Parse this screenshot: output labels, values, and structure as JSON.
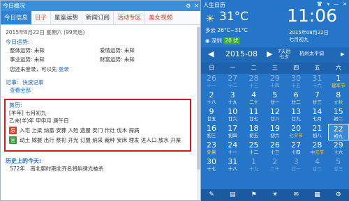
{
  "popup": {
    "title": "今日概况",
    "tabs": [
      {
        "label": "今日信息",
        "active": true,
        "red": false
      },
      {
        "label": "日子",
        "active": false,
        "red": true
      },
      {
        "label": "星座运势",
        "active": false,
        "red": false
      },
      {
        "label": "新闻订阅",
        "active": false,
        "red": false
      },
      {
        "label": "活动专区",
        "active": false,
        "red": true
      },
      {
        "label": "美女视频",
        "active": false,
        "red": true
      }
    ],
    "date_line": "2015年8月22日 星期六 (99天后)",
    "fortune_title": "今日运势:",
    "fortune": [
      [
        "整体运势: 未知",
        "爱情运势: 未知"
      ],
      [
        "事业运势: 未知",
        "财富运势: 未知"
      ]
    ],
    "login_text": "您还未登录，可以先",
    "login_link": "登录",
    "memo_title": "记事:",
    "memo_link": "快速记事",
    "view_all": "查看全部",
    "almanac_title": "黄历:",
    "almanac_line1": "[羊年] 七月初九",
    "almanac_line2": "乙未(羊)年 甲申月 庚午日",
    "ji_label": "忌",
    "ji_text": "入宅 上梁 纳畜 安葬 入殓 造屋 安门 作灶 伐木 探病",
    "yi_label": "宜",
    "yi_text": "动土 嫁娶 出行 祭祀 开光 订盟 纳采 裁种 安床 理发 进人口 放水 开渠",
    "history_title": "历史上的今天:",
    "history_item": "572年　南北朝时期北齐名将斛律光被杀"
  },
  "calendar": {
    "title": "人生日历",
    "weather_icon": "☀",
    "temperature": "31°C",
    "temp_range": "多云 26°C~31°C",
    "city": "深圳",
    "aqi": "20 优",
    "time": "11:06",
    "date_small": "2015年08月22日",
    "lunar_small": "七月初九",
    "month": "2015-08",
    "prev": "◀",
    "next": "▶",
    "holiday_line1": "7天后",
    "holiday_line2": "七夕",
    "timezone": "杭州太平调",
    "weekdays": [
      "日",
      "一",
      "二",
      "三",
      "四",
      "五",
      "六"
    ],
    "days": [
      {
        "d": "26",
        "s": "十一",
        "o": true
      },
      {
        "d": "27",
        "s": "十二",
        "o": true
      },
      {
        "d": "28",
        "s": "十三",
        "o": true
      },
      {
        "d": "29",
        "s": "十四",
        "o": true
      },
      {
        "d": "30",
        "s": "十五",
        "o": true
      },
      {
        "d": "31",
        "s": "十六",
        "o": true
      },
      {
        "d": "1",
        "s": "建军节",
        "h": true
      },
      {
        "d": "2",
        "s": "十八"
      },
      {
        "d": "3",
        "s": "十九"
      },
      {
        "d": "4",
        "s": "二十"
      },
      {
        "d": "5",
        "s": "廿一"
      },
      {
        "d": "6",
        "s": "廿二"
      },
      {
        "d": "7",
        "s": "廿三"
      },
      {
        "d": "8",
        "s": "立秋",
        "h": true
      },
      {
        "d": "9",
        "s": "廿五"
      },
      {
        "d": "10",
        "s": "廿六"
      },
      {
        "d": "11",
        "s": "廿七"
      },
      {
        "d": "12",
        "s": "廿八"
      },
      {
        "d": "13",
        "s": "廿九"
      },
      {
        "d": "14",
        "s": "七月"
      },
      {
        "d": "15",
        "s": "初二"
      },
      {
        "d": "16",
        "s": "初三"
      },
      {
        "d": "17",
        "s": "初四"
      },
      {
        "d": "18",
        "s": "初五"
      },
      {
        "d": "19",
        "s": "初六"
      },
      {
        "d": "20",
        "s": "七夕节",
        "h": true
      },
      {
        "d": "21",
        "s": "初八"
      },
      {
        "d": "22",
        "s": "初九",
        "t": true
      },
      {
        "d": "23",
        "s": "处暑",
        "h": true
      },
      {
        "d": "24",
        "s": "十一"
      },
      {
        "d": "25",
        "s": "十二"
      },
      {
        "d": "26",
        "s": "十三"
      },
      {
        "d": "27",
        "s": "十四"
      },
      {
        "d": "28",
        "s": "中元节",
        "h": true
      },
      {
        "d": "29",
        "s": "十六"
      },
      {
        "d": "30",
        "s": "十七"
      },
      {
        "d": "31",
        "s": "十八"
      },
      {
        "d": "1",
        "s": "十九",
        "o": true
      },
      {
        "d": "2",
        "s": "二十",
        "o": true
      },
      {
        "d": "3",
        "s": "廿一",
        "o": true
      },
      {
        "d": "4",
        "s": "廿二",
        "o": true
      },
      {
        "d": "5",
        "s": "廿三",
        "o": true
      }
    ],
    "toolbar": [
      "✎",
      "▤",
      "⚑",
      "☀",
      "✉",
      "▦",
      "⚙"
    ]
  }
}
